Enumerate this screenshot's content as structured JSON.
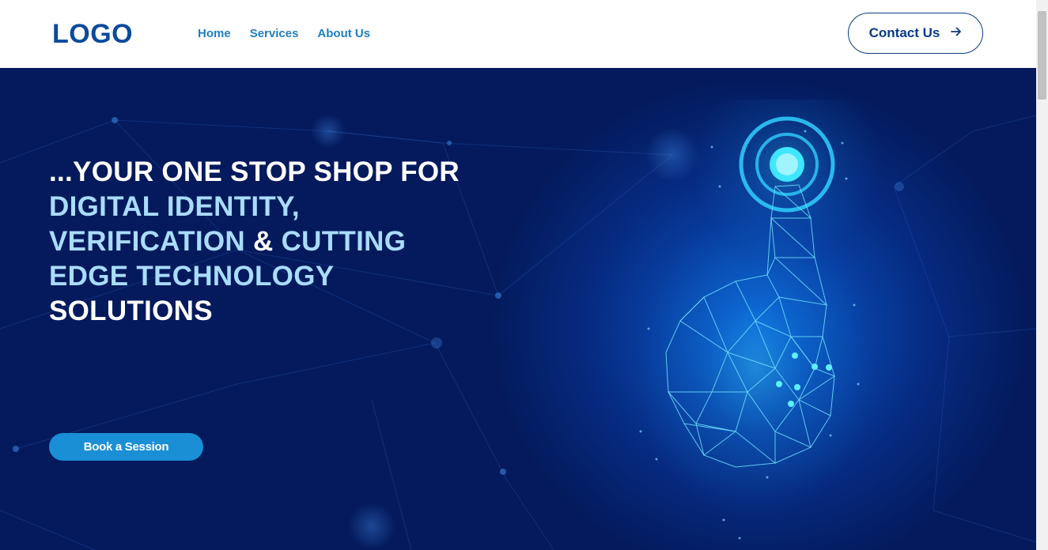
{
  "header": {
    "logo": "LOGO",
    "nav": [
      {
        "label": "Home"
      },
      {
        "label": "Services"
      },
      {
        "label": "About Us"
      }
    ],
    "contact_label": "Contact Us",
    "contact_icon": "arrow-right-icon"
  },
  "hero": {
    "line1": "...YOUR ONE STOP SHOP FOR",
    "line2": "DIGITAL IDENTITY,",
    "line3_a": "VERIFICATION",
    "line3_b": " & ",
    "line3_c": "CUTTING",
    "line4": "EDGE TECHNOLOGY",
    "line5": "SOLUTIONS",
    "cta_label": "Book a Session",
    "image": "glowing-polygon-hand-touch-icon"
  },
  "colors": {
    "brand": "#0b4a9c",
    "nav": "#1e7fc4",
    "hero_bg": "#041a5c",
    "highlight": "#a9dcff",
    "cta": "#1a8fd6"
  }
}
